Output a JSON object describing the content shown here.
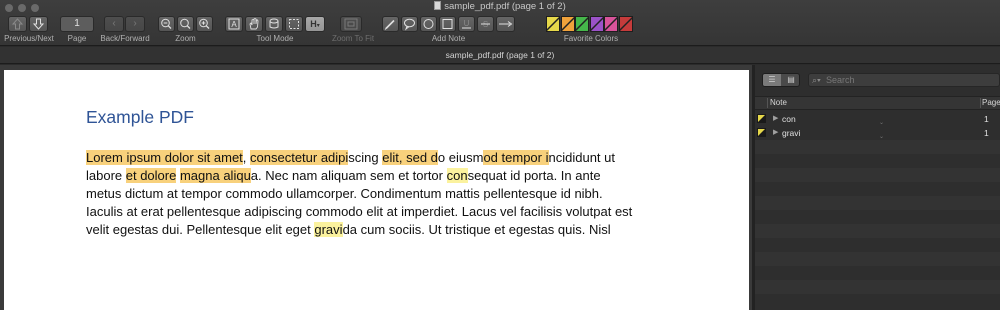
{
  "window": {
    "title": "sample_pdf.pdf (page 1 of 2)"
  },
  "toolbar": {
    "previous_next_label": "Previous/Next",
    "page_label": "Page",
    "page_value": "1",
    "back_forward_label": "Back/Forward",
    "zoom_label": "Zoom",
    "tool_mode_label": "Tool Mode",
    "zoom_to_fit_label": "Zoom To Fit",
    "add_note_label": "Add Note",
    "favorite_colors_label": "Favorite Colors",
    "highlight_tool_glyph": "H",
    "icons": {
      "previous": "arrow-up-icon",
      "next": "arrow-down-icon",
      "back": "chevron-left-icon",
      "forward": "chevron-right-icon",
      "zoom_out": "zoom-out-icon",
      "zoom_actual": "zoom-actual-icon",
      "zoom_in": "zoom-in-icon",
      "text_tool": "text-select-icon",
      "hand_tool": "hand-icon",
      "annotate_tool": "annotate-icon",
      "marquee_tool": "marquee-icon",
      "highlight_tool": "highlight-icon",
      "zoom_to_fit": "zoom-to-fit-icon",
      "note_pen": "pen-icon",
      "note_bubble": "speech-bubble-icon",
      "note_circle": "circle-icon",
      "note_box": "box-icon",
      "note_underline": "underline-icon",
      "note_strike": "strikethrough-icon",
      "note_line": "arrow-line-icon"
    },
    "favorite_colors": [
      "#e6d84a",
      "#f0a23b",
      "#45b64a",
      "#9b52c8",
      "#d8539a",
      "#c63b3b"
    ]
  },
  "document_bar": {
    "title": "sample_pdf.pdf (page 1 of 2)"
  },
  "pdf": {
    "heading": "Example PDF",
    "lines": [
      [
        "Lorem ipsum dolor sit amet",
        ", ",
        "consectetur adipi",
        "scing ",
        "elit, sed d",
        "o eiusm",
        "od tempor i",
        "ncididunt ut"
      ],
      [
        "labore ",
        "et dolore",
        " ",
        "magna aliqu",
        "a. Nec nam aliquam sem et tortor ",
        "con",
        "sequat id porta. In ante"
      ],
      [
        "metus dictum at tempor commodo ullamcorper. Condimentum mattis pellentesque id nibh."
      ],
      [
        "Iaculis at erat pellentesque adipiscing commodo elit at imperdiet. Lacus vel facilisis volutpat est"
      ],
      [
        "velit egestas dui. Pellentesque elit eget ",
        "gravi",
        "da cum sociis. Ut tristique et egestas quis. Nisl"
      ]
    ]
  },
  "notes_panel": {
    "search_placeholder": "Search",
    "columns": {
      "note": "Note",
      "page": "Page"
    },
    "rows": [
      {
        "color": "#e6d84a",
        "name": "con",
        "page": "1"
      },
      {
        "color": "#e6d84a",
        "name": "gravi",
        "page": "1"
      }
    ]
  }
}
